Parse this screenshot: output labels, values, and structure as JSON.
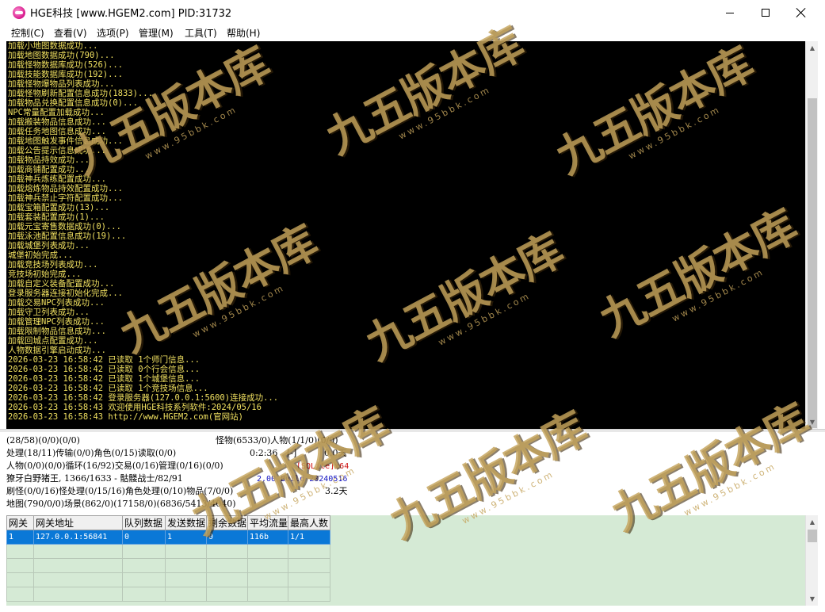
{
  "window": {
    "title": "HGE科技 [www.HGEM2.com] PID:31732"
  },
  "menu": [
    "控制(C)",
    "查看(V)",
    "选项(P)",
    "管理(M)",
    "工具(T)",
    "帮助(H)"
  ],
  "console_lines": [
    "加载小地图数据成功...",
    "加载地图数据成功(790)...",
    "加载怪物数据库成功(526)...",
    "加载技能数据库成功(192)...",
    "加载怪物爆物品列表成功...",
    "加载怪物刷新配置信息成功(1833)...",
    "加载物品兑换配置信息成功(0)...",
    "NPC常量配置加载成功...",
    "加载搬装物品信息成功...",
    "加载任务地图信息成功...",
    "加载地图触发事件信息成功...",
    "加载公告提示信息成功...",
    "加载物品持效成功...",
    "加载商铺配置成功...",
    "加载神兵炼练配置成功...",
    "加载熔炼物品持效配置成功...",
    "加载神兵禁止字符配置成功...",
    "加载宝箱配置成功(13)...",
    "加载套装配置成功(1)...",
    "加载元宝寄售数据成功(0)...",
    "加载泳池配置信息成功(19)...",
    "加载城堡列表成功...",
    "城堡初始完成...",
    "加载竞技场列表成功...",
    "竞技场初始完成...",
    "加载自定义装备配置成功...",
    "登录服务器连接初始化完成...",
    "加载交易NPC列表成功...",
    "加载守卫列表成功...",
    "加载管理NPC列表成功...",
    "加载限制物品信息成功...",
    "加载回城点配置成功...",
    "人物数据引擎启动成功...",
    "2026-03-23 16:58:42 已读取 1个师门信息...",
    "2026-03-23 16:58:42 已读取 0个行会信息...",
    "2026-03-23 16:58:42 已读取 1个城堡信息...",
    "2026-03-23 16:58:42 已读取 1个竞技场信息...",
    "2026-03-23 16:58:42 登录服务器(127.0.0.1:5600)连接成功...",
    "2026-03-23 16:58:43 欢迎使用HGE科技系列软件:2024/05/16",
    "2026-03-23 16:58:43 http://www.HGEM2.com(官网站)"
  ],
  "status": {
    "r1_left": "(28/58)(0/0)(0/0)",
    "r1_right": "怪物(6533/0)人物(1/1/0)(0/0)",
    "r2_left": "处理(18/11)传输(0/0)角色(0/15)读取(0/0)",
    "r2_time": "0:2:36",
    "r2_flag": "[-]",
    "r2_days": "0.0天",
    "r3_left": "人物(0/0)(0/0)循环(16/92)交易(0/16)管理(0/16)(0/0)",
    "r3_tag": "[SQLite]x64",
    "r4_left": "獠牙白野猪王, 1366/1633 - 骷髅战士/82/91",
    "r4_build": "2.00 Build 20240516",
    "r5_left": "刷怪(0/0/16)怪处理(0/15/16)角色处理(0/10)物品(7/0/0)",
    "r5_days": "3.2天",
    "r6_left": "地图(790/0/0)场景(862/0)(17158/0)(6836/5413/4040)"
  },
  "grid": {
    "headers": [
      "网关",
      "网关地址",
      "队列数据",
      "发送数据",
      "剩余数据",
      "平均流量",
      "最高人数"
    ],
    "rows": [
      [
        "1",
        "127.0.0.1:56841",
        "0",
        "1",
        "0",
        "116b",
        "1/1"
      ]
    ]
  },
  "watermark": {
    "text": "九五版本库",
    "sub": "www.95bbk.com"
  },
  "colors": {
    "console_bg": "#000000",
    "console_text": "#f0e060",
    "grid_bg": "#d5ead5",
    "grid_selected": "#0a78d7"
  }
}
